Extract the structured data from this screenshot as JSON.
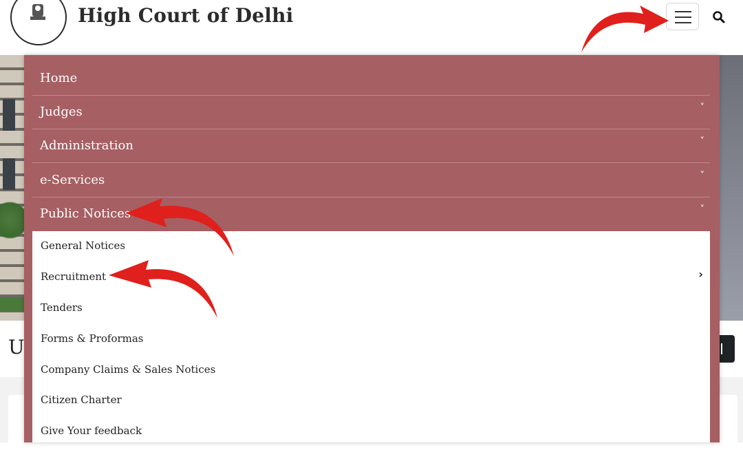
{
  "header": {
    "title": "High Court of Delhi",
    "logo_icon": "emblem-logo-icon",
    "menu_icon": "hamburger-icon",
    "search_icon": "search-icon"
  },
  "background": {
    "partial_heading": "U"
  },
  "menu": {
    "items": [
      {
        "label": "Home",
        "has_submenu": false
      },
      {
        "label": "Judges",
        "has_submenu": true
      },
      {
        "label": "Administration",
        "has_submenu": true
      },
      {
        "label": "e-Services",
        "has_submenu": true
      },
      {
        "label": "Public Notices",
        "has_submenu": true,
        "expanded": true
      }
    ],
    "chevron": "˅",
    "submenu": [
      {
        "label": "General Notices"
      },
      {
        "label": "Recruitment",
        "arrow": "›"
      },
      {
        "label": "Tenders"
      },
      {
        "label": "Forms & Proformas"
      },
      {
        "label": "Company Claims & Sales Notices"
      },
      {
        "label": "Citizen Charter"
      },
      {
        "label": "Give Your feedback"
      }
    ]
  },
  "colors": {
    "menu_bg": "#a65f63",
    "annotation_arrow": "#e0201c"
  }
}
